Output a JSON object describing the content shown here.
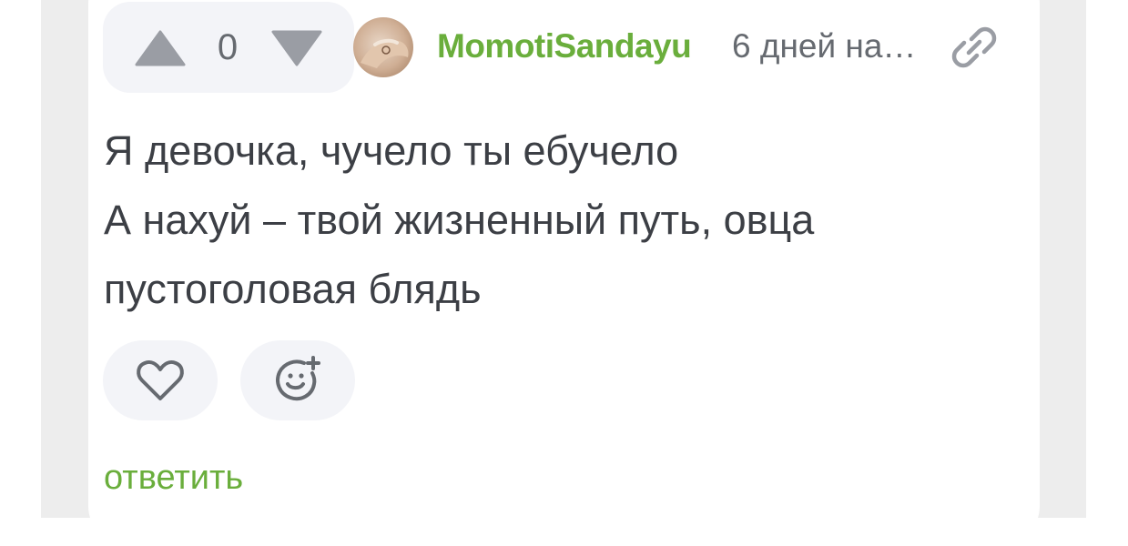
{
  "comment": {
    "votes": {
      "count": "0"
    },
    "author": {
      "username": "MomotiSandayu"
    },
    "timestamp": "6 дней на…",
    "text_lines": [
      "Я девочка, чучело ты ебучело",
      "А нахуй – твой жизненный путь, овца",
      "пустоголовая блядь"
    ],
    "reply_label": "ответить"
  },
  "colors": {
    "accent_green": "#6aae3c",
    "icon_gray": "#9a9da4",
    "text_dark": "#3c3f45",
    "text_muted": "#666a70",
    "pill_bg": "#f3f4f8",
    "page_bg": "#ededed"
  },
  "icons": {
    "upvote": "triangle-up-icon",
    "downvote": "triangle-down-icon",
    "link": "chain-link-icon",
    "like": "heart-outline-icon",
    "add_reaction": "smiley-plus-icon"
  }
}
